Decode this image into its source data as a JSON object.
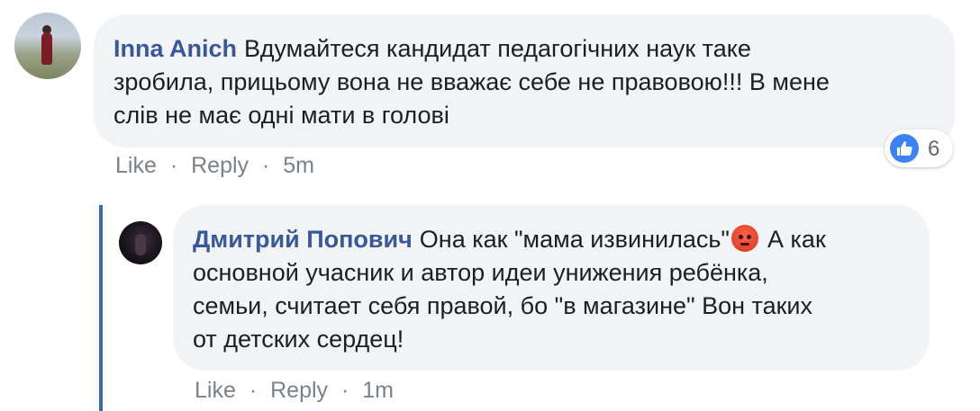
{
  "comment": {
    "author": "Inna Anich",
    "lines": [
      "Вдумайтеся кандидат педагогічних наук таке",
      "зробила, прицьому вона не вважає себе не правовою!!! В мене",
      "слів не має одні мати в голові"
    ],
    "actions": {
      "like": "Like",
      "reply": "Reply",
      "time": "5m",
      "sep": "·"
    },
    "reactions": {
      "icon": "like-icon",
      "count": "6"
    }
  },
  "reply": {
    "author": "Дмитрий Попович",
    "line1_before_emoji": "Она как \"мама извинилась\"",
    "emoji": "angry-face-icon",
    "line1_after_emoji": "А как",
    "lines": [
      "основной учасник и автор идеи унижения ребёнка,",
      "семьи, считает себя правой, бо \"в магазине\" Вон таких",
      "от детских сердец!"
    ],
    "actions": {
      "like": "Like",
      "reply": "Reply",
      "time": "1m",
      "sep": "·"
    }
  },
  "colors": {
    "author": "#385898",
    "bubble": "#f2f3f5",
    "reply_bar": "#4267b2",
    "like": "#3b82f6"
  }
}
